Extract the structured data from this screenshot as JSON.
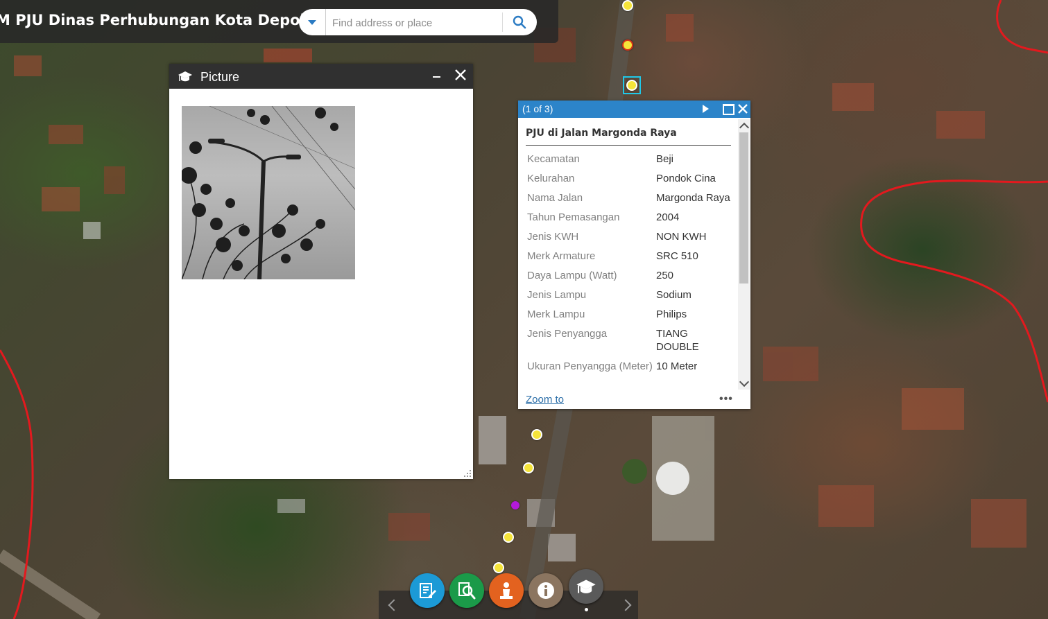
{
  "header": {
    "title": "M PJU Dinas Perhubungan Kota Depok",
    "search_placeholder": "Find address or place"
  },
  "picture_panel": {
    "title": "Picture"
  },
  "popup": {
    "count": "(1 of 3)",
    "title": "PJU di Jalan Margonda Raya",
    "attributes": [
      {
        "key": "Kecamatan",
        "value": "Beji"
      },
      {
        "key": "Kelurahan",
        "value": "Pondok Cina"
      },
      {
        "key": "Nama Jalan",
        "value": "Margonda Raya"
      },
      {
        "key": "Tahun Pemasangan",
        "value": "2004"
      },
      {
        "key": "Jenis KWH",
        "value": "NON KWH"
      },
      {
        "key": "Merk Armature",
        "value": "SRC 510"
      },
      {
        "key": "Daya Lampu (Watt)",
        "value": "250"
      },
      {
        "key": "Jenis Lampu",
        "value": "Sodium"
      },
      {
        "key": "Merk Lampu",
        "value": "Philips"
      },
      {
        "key": "Jenis Penyangga",
        "value": "TIANG DOUBLE"
      },
      {
        "key": "Ukuran Penyangga (Meter)",
        "value": "10 Meter"
      }
    ],
    "zoom_to": "Zoom to",
    "more": "•••"
  },
  "toolbar": {
    "buttons": [
      {
        "icon": "edit-icon",
        "color": "#1c9ad6"
      },
      {
        "icon": "search-layer-icon",
        "color": "#1b9a49"
      },
      {
        "icon": "legend-person-icon",
        "color": "#e3621f"
      },
      {
        "icon": "info-icon",
        "color": "#8b7560"
      },
      {
        "icon": "picture-icon",
        "color": "#5a5a5a"
      }
    ]
  },
  "colors": {
    "header_bg": "#282828",
    "popup_header": "#2c84c9",
    "boundary_line": "#e3191e",
    "marker_yellow": "#f5e43a"
  }
}
